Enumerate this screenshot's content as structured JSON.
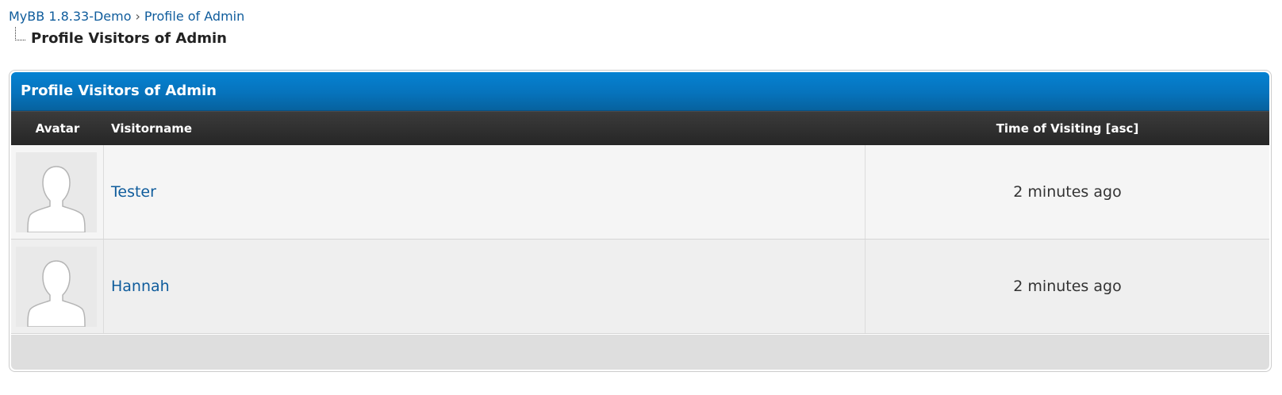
{
  "breadcrumb": {
    "items": [
      {
        "label": "MyBB 1.8.33-Demo"
      },
      {
        "label": "Profile of Admin"
      }
    ],
    "separator": "›",
    "active": "Profile Visitors of Admin"
  },
  "table": {
    "title": "Profile Visitors of Admin",
    "columns": {
      "avatar": "Avatar",
      "visitorname": "Visitorname",
      "time": "Time of Visiting [asc]"
    },
    "rows": [
      {
        "name": "Tester",
        "time": "2 minutes ago",
        "avatar_icon": "default-avatar-icon"
      },
      {
        "name": "Hannah",
        "time": "2 minutes ago",
        "avatar_icon": "default-avatar-icon"
      }
    ]
  },
  "colors": {
    "link": "#0f5c9c",
    "thead": "#0673bc",
    "tcat": "#2c2c2c",
    "row_odd": "#f5f5f5",
    "row_even": "#efefef",
    "footer": "#dedede"
  }
}
